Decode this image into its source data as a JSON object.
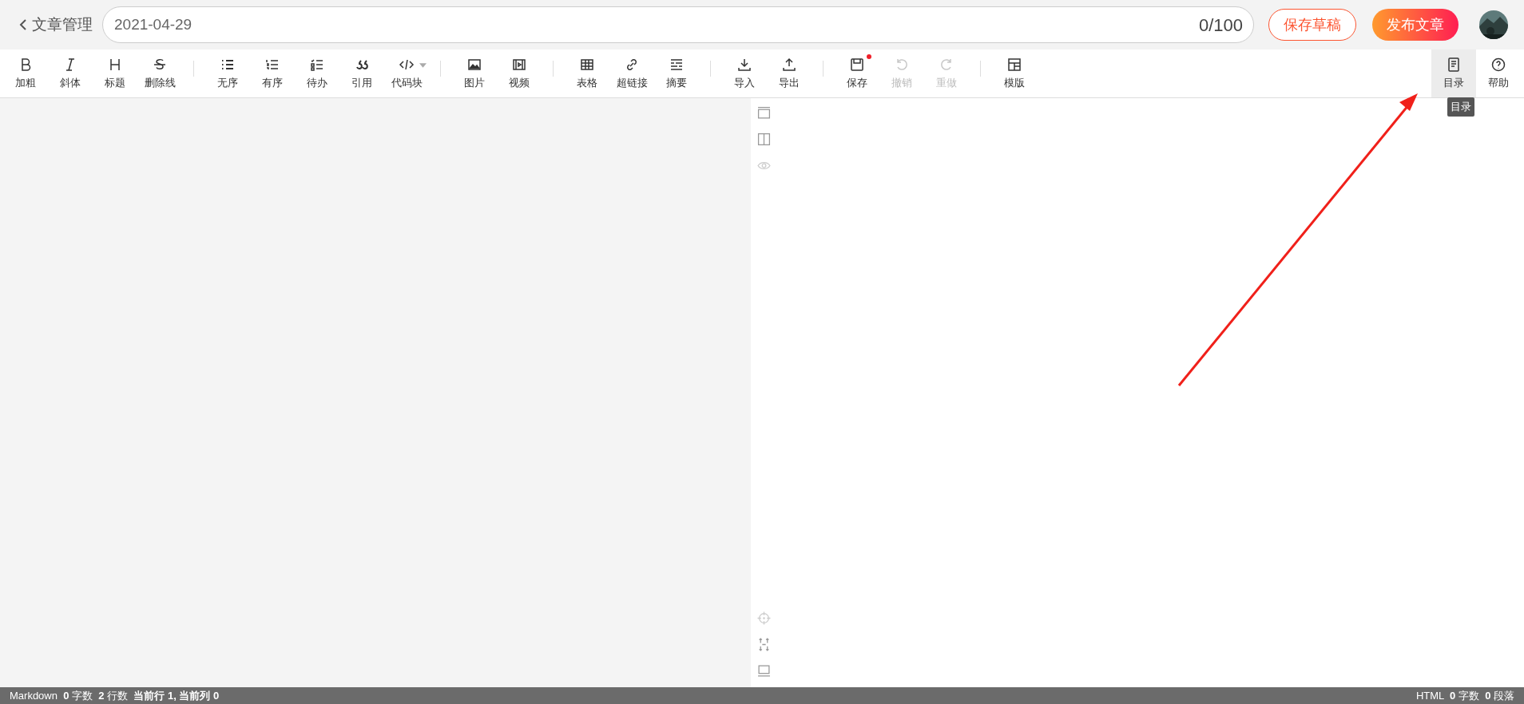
{
  "header": {
    "back_label": "文章管理",
    "title_value": "2021-04-29",
    "counter": "0/100",
    "draft_button": "保存草稿",
    "publish_button": "发布文章"
  },
  "toolbar": {
    "groups": [
      [
        {
          "kind": "bold",
          "label": "加粗",
          "disabled": false,
          "selected": false
        },
        {
          "kind": "italic",
          "label": "斜体",
          "disabled": false,
          "selected": false
        },
        {
          "kind": "heading",
          "label": "标题",
          "disabled": false,
          "selected": false
        },
        {
          "kind": "strike",
          "label": "删除线",
          "disabled": false,
          "selected": false
        }
      ],
      [
        {
          "kind": "ul",
          "label": "无序",
          "disabled": false,
          "selected": false
        },
        {
          "kind": "ol",
          "label": "有序",
          "disabled": false,
          "selected": false
        },
        {
          "kind": "todo",
          "label": "待办",
          "disabled": false,
          "selected": false
        },
        {
          "kind": "quote",
          "label": "引用",
          "disabled": false,
          "selected": false
        },
        {
          "kind": "code",
          "label": "代码块",
          "disabled": false,
          "selected": false
        }
      ],
      [
        {
          "kind": "image",
          "label": "图片",
          "disabled": false,
          "selected": false
        },
        {
          "kind": "video",
          "label": "视频",
          "disabled": false,
          "selected": false
        }
      ],
      [
        {
          "kind": "table",
          "label": "表格",
          "disabled": false,
          "selected": false
        },
        {
          "kind": "link",
          "label": "超链接",
          "disabled": false,
          "selected": false
        },
        {
          "kind": "summary",
          "label": "摘要",
          "disabled": false,
          "selected": false
        }
      ],
      [
        {
          "kind": "import",
          "label": "导入",
          "disabled": false,
          "selected": false
        },
        {
          "kind": "export",
          "label": "导出",
          "disabled": false,
          "selected": false
        }
      ],
      [
        {
          "kind": "save",
          "label": "保存",
          "disabled": false,
          "selected": false,
          "unsaved": true
        },
        {
          "kind": "undo",
          "label": "撤销",
          "disabled": true,
          "selected": false
        },
        {
          "kind": "redo",
          "label": "重做",
          "disabled": true,
          "selected": false
        }
      ],
      [
        {
          "kind": "template",
          "label": "模版",
          "disabled": false,
          "selected": false
        }
      ]
    ],
    "right": [
      {
        "kind": "toc",
        "label": "目录",
        "disabled": false,
        "selected": true,
        "tooltip": "目录"
      },
      {
        "kind": "help",
        "label": "帮助",
        "disabled": false,
        "selected": false
      }
    ]
  },
  "status_bar": {
    "left": "Markdown  **0** 字数  **2** 行数  **当前行 1, 当前列 0**",
    "right": "HTML  **0** 字数  **0** 段落"
  }
}
